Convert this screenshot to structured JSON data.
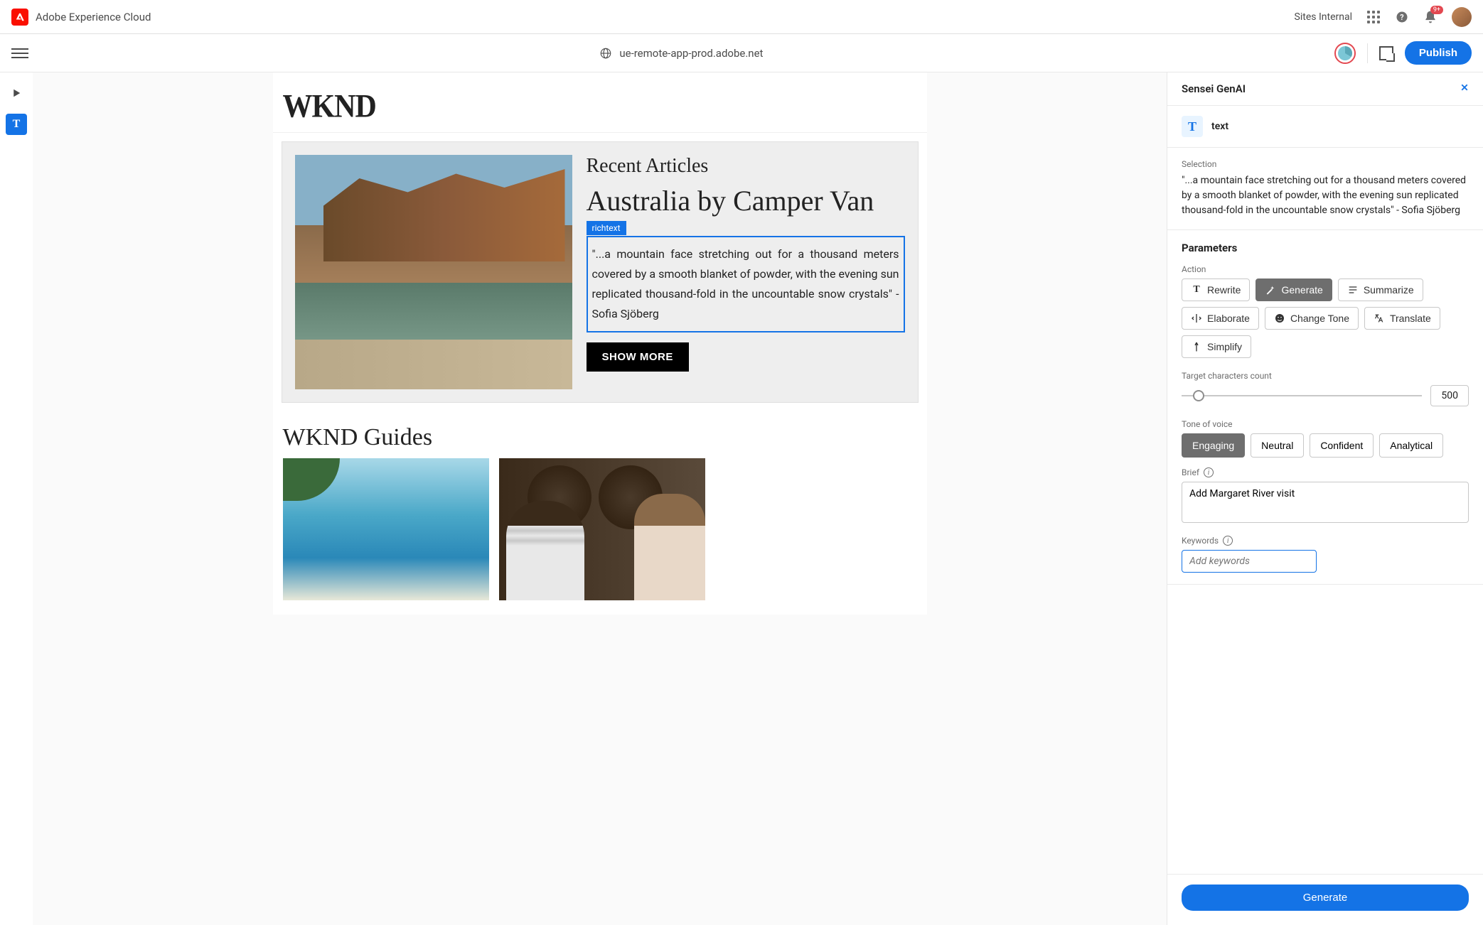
{
  "header": {
    "brand": "Adobe Experience Cloud",
    "sites_label": "Sites Internal",
    "notif_badge": "9+"
  },
  "url_bar": {
    "host": "ue-remote-app-prod.adobe.net",
    "publish_label": "Publish"
  },
  "canvas": {
    "site_logo": "WKND",
    "recent_heading": "Recent Articles",
    "article_headline": "Australia by Camper Van",
    "richtext_label": "richtext",
    "selected_paragraph": "\"...a mountain face stretching out for a thousand meters covered by a smooth blanket of powder, with the evening sun replicated thousand-fold in the uncountable snow crystals\" - Sofia Sjöberg",
    "show_more": "SHOW MORE",
    "guides_heading": "WKND Guides"
  },
  "panel": {
    "title": "Sensei GenAI",
    "component_type": "text",
    "selection_label": "Selection",
    "selection_text": "\"...a mountain face stretching out for a thousand meters covered by a smooth blanket of powder, with the evening sun replicated thousand-fold in the uncountable snow crystals\" - Sofia Sjöberg",
    "parameters_label": "Parameters",
    "action_label": "Action",
    "actions": {
      "rewrite": "Rewrite",
      "generate": "Generate",
      "summarize": "Summarize",
      "elaborate": "Elaborate",
      "change_tone": "Change Tone",
      "translate": "Translate",
      "simplify": "Simplify"
    },
    "target_chars_label": "Target characters count",
    "target_chars_value": "500",
    "tone_label": "Tone of voice",
    "tones": {
      "engaging": "Engaging",
      "neutral": "Neutral",
      "confident": "Confident",
      "analytical": "Analytical"
    },
    "brief_label": "Brief",
    "brief_value": "Add Margaret River visit",
    "keywords_label": "Keywords",
    "keywords_placeholder": "Add keywords",
    "generate_button": "Generate"
  }
}
